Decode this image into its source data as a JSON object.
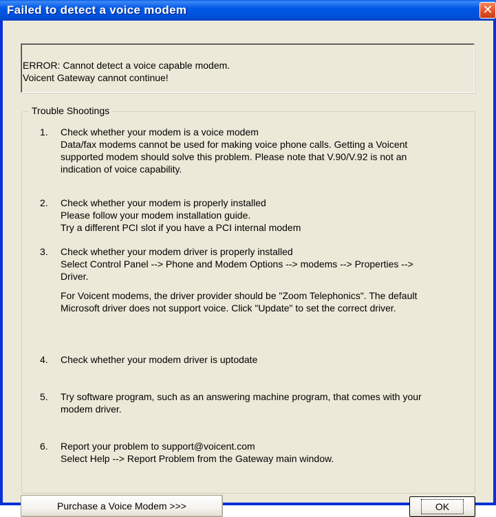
{
  "window": {
    "title": "Failed to detect a voice modem",
    "close_glyph": "✕"
  },
  "error": {
    "line1": "ERROR: Cannot detect a voice capable modem.",
    "line2": "Voicent Gateway cannot continue!"
  },
  "troubleshooting": {
    "label": "Trouble Shootings",
    "items": [
      {
        "number": "1.",
        "lines": [
          "Check whether your modem is a voice modem",
          "Data/fax modems cannot be used for making voice phone calls. Getting a Voicent",
          "supported modem should solve this problem.  Please note that V.90/V.92 is not an",
          "indication of voice capability."
        ]
      },
      {
        "number": "2.",
        "lines": [
          "Check whether your modem is properly installed",
          "Please follow your modem installation guide.",
          "Try a different PCI slot if you have a PCI internal modem"
        ]
      },
      {
        "number": "3.",
        "lines": [
          "Check whether your modem driver is properly installed",
          "Select Control Panel --> Phone and Modem Options --> modems --> Properties -->",
          "Driver.",
          "",
          "For Voicent modems, the driver provider should be \"Zoom Telephonics\". The default",
          "Microsoft driver does not support voice. Click \"Update\" to set the correct driver."
        ]
      },
      {
        "number": "4.",
        "lines": [
          "Check whether your modem driver is uptodate"
        ]
      },
      {
        "number": "5.",
        "lines": [
          "Try software program, such as an answering machine program, that comes with your",
          "modem driver."
        ]
      },
      {
        "number": "6.",
        "lines": [
          "Report your problem to support@voicent.com",
          "Select Help --> Report Problem from the Gateway main window."
        ]
      }
    ]
  },
  "buttons": {
    "purchase_label": "Purchase a Voice Modem >>>",
    "ok_label": "OK"
  }
}
